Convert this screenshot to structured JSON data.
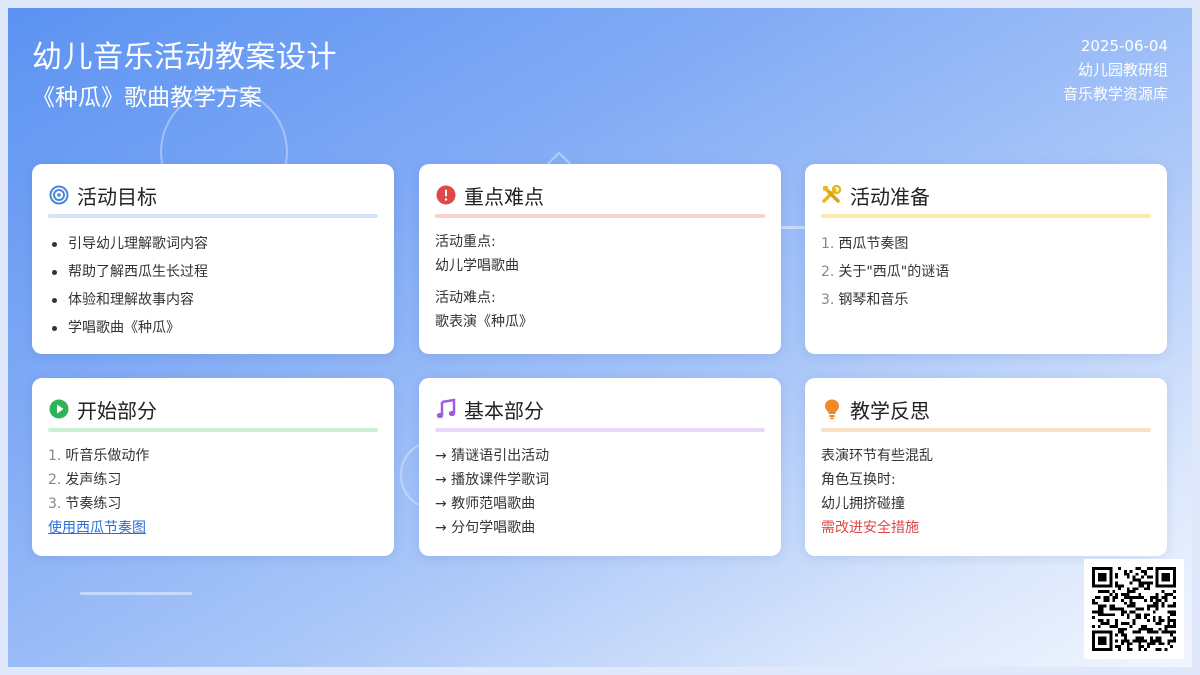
{
  "header": {
    "title": "幼儿音乐活动教案设计",
    "subtitle": "《种瓜》歌曲教学方案",
    "date": "2025-06-04",
    "org": "幼儿园教研组",
    "library": "音乐教学资源库"
  },
  "cards": {
    "goals": {
      "title": "活动目标",
      "icon": "target-icon",
      "color": "#4a86d8",
      "items": [
        "引导幼儿理解歌词内容",
        "帮助了解西瓜生长过程",
        "体验和理解故事内容",
        "学唱歌曲《种瓜》"
      ]
    },
    "keypoints": {
      "title": "重点难点",
      "icon": "exclamation-icon",
      "color": "#e04848",
      "focus_label": "活动重点:",
      "focus_value": "幼儿学唱歌曲",
      "difficulty_label": "活动难点:",
      "difficulty_value": "歌表演《种瓜》"
    },
    "prep": {
      "title": "活动准备",
      "icon": "tools-icon",
      "color": "#e8b820",
      "items": [
        "西瓜节奏图",
        "关于\"西瓜\"的谜语",
        "钢琴和音乐"
      ]
    },
    "start": {
      "title": "开始部分",
      "icon": "play-icon",
      "color": "#2fb35a",
      "items": [
        "听音乐做动作",
        "发声练习",
        "节奏练习"
      ],
      "link": "使用西瓜节奏图"
    },
    "basic": {
      "title": "基本部分",
      "icon": "music-note-icon",
      "color": "#9b5de5",
      "items": [
        "→ 猜谜语引出活动",
        "→ 播放课件学歌词",
        "→ 教师范唱歌曲",
        "→ 分句学唱歌曲"
      ]
    },
    "reflect": {
      "title": "教学反思",
      "icon": "lightbulb-icon",
      "color": "#f08a24",
      "lines": [
        "表演环节有些混乱",
        "角色互换时:",
        "幼儿拥挤碰撞"
      ],
      "warning": "需改进安全措施"
    }
  }
}
